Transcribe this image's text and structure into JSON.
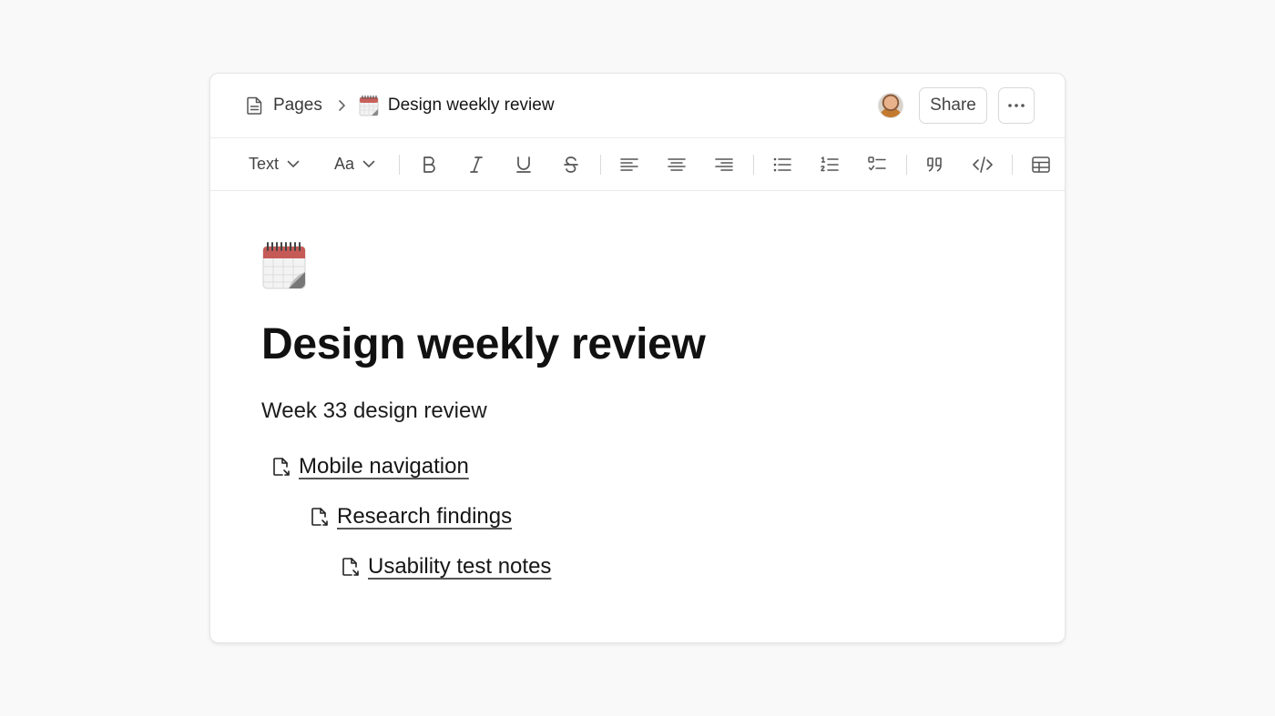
{
  "breadcrumb": {
    "root_label": "Pages",
    "current_label": "Design weekly review"
  },
  "header": {
    "share_label": "Share"
  },
  "toolbar": {
    "block_type": "Text",
    "font_menu": "Aa"
  },
  "page": {
    "icon": "calendar-emoji",
    "title": "Design weekly review",
    "description": "Week 33 design review",
    "links": [
      {
        "label": "Mobile navigation"
      },
      {
        "label": "Research findings"
      },
      {
        "label": "Usability test notes"
      }
    ]
  }
}
